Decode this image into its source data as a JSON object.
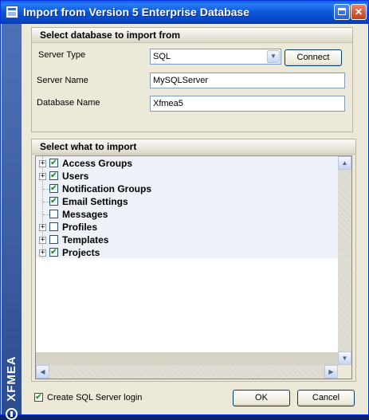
{
  "window": {
    "title": "Import from Version 5 Enterprise Database"
  },
  "sidebar": {
    "brand": "XFMEA"
  },
  "db_group": {
    "header": "Select database to import from",
    "server_type_label": "Server Type",
    "server_type_value": "SQL",
    "connect_label": "Connect",
    "server_name_label": "Server Name",
    "server_name_value": "MySQLServer",
    "database_name_label": "Database Name",
    "database_name_value": "Xfmea5"
  },
  "import_group": {
    "header": "Select what to import",
    "items": [
      {
        "label": "Access Groups",
        "checked": true,
        "expandable": true
      },
      {
        "label": "Users",
        "checked": true,
        "expandable": true
      },
      {
        "label": "Notification Groups",
        "checked": true,
        "expandable": false
      },
      {
        "label": "Email Settings",
        "checked": true,
        "expandable": false
      },
      {
        "label": "Messages",
        "checked": false,
        "expandable": false
      },
      {
        "label": "Profiles",
        "checked": false,
        "expandable": true
      },
      {
        "label": "Templates",
        "checked": false,
        "expandable": true
      },
      {
        "label": "Projects",
        "checked": true,
        "expandable": true
      }
    ]
  },
  "footer": {
    "create_login_label": "Create SQL Server login",
    "create_login_checked": true,
    "ok_label": "OK",
    "cancel_label": "Cancel"
  },
  "glyphs": {
    "check": "✔",
    "plus": "+",
    "close": "✕",
    "arrow_down": "▼",
    "arrow_up": "▲",
    "arrow_left": "◀",
    "arrow_right": "▶"
  }
}
